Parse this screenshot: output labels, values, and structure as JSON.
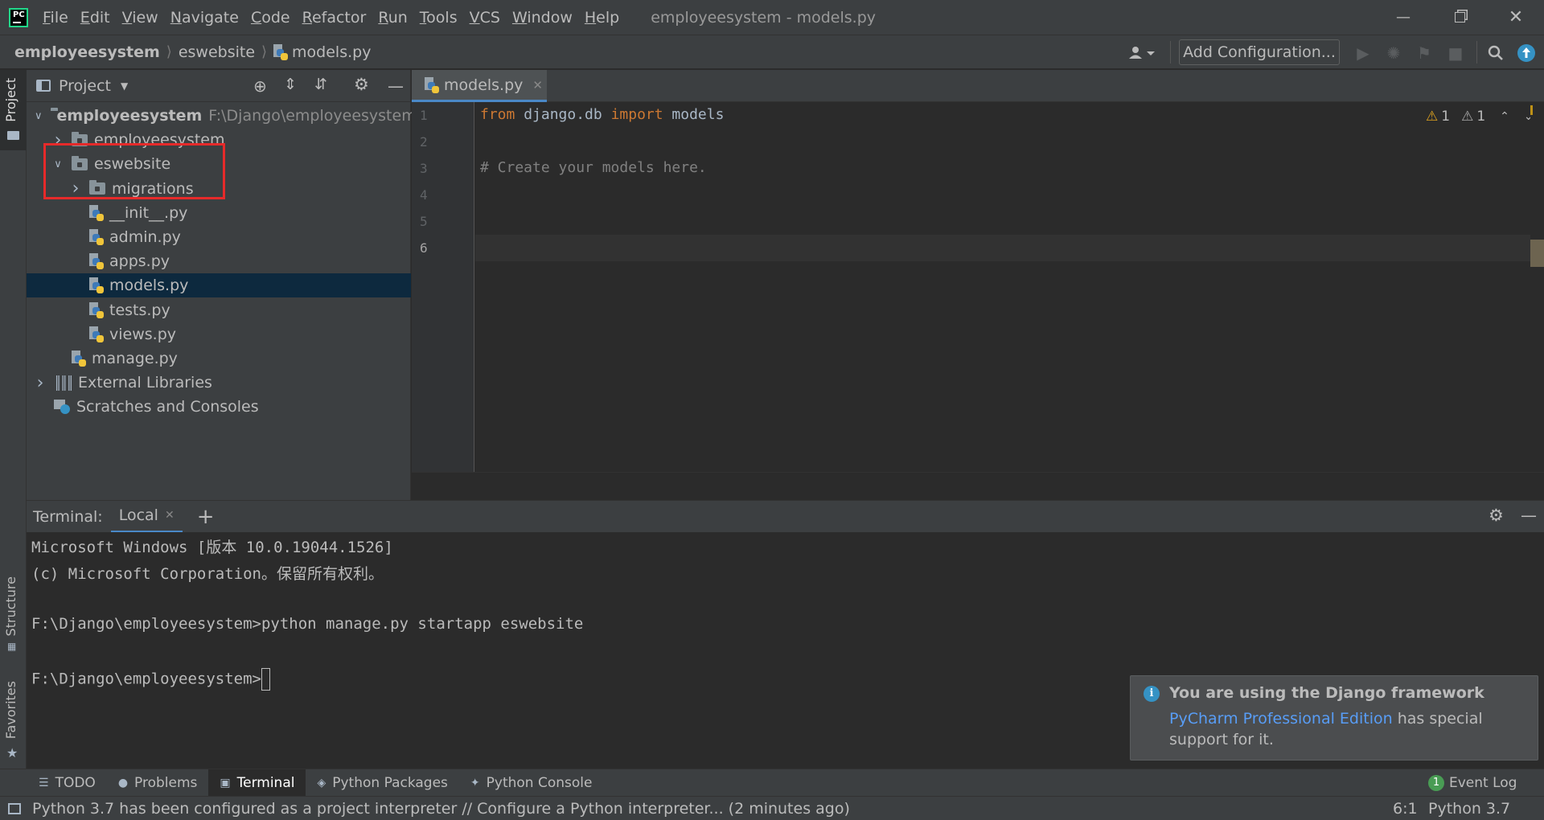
{
  "app": {
    "logo_text": "PC",
    "window_title": "employeesystem - models.py"
  },
  "menu": [
    "File",
    "Edit",
    "View",
    "Navigate",
    "Code",
    "Refactor",
    "Run",
    "Tools",
    "VCS",
    "Window",
    "Help"
  ],
  "menu_mnemonics": [
    "F",
    "E",
    "V",
    "N",
    "C",
    "R",
    "R",
    "T",
    "V",
    "W",
    "H"
  ],
  "breadcrumb": [
    "employeesystem",
    "eswebsite",
    "models.py"
  ],
  "toolbar": {
    "add_configuration": "Add Configuration..."
  },
  "left_strip": {
    "project": "Project",
    "structure": "Structure",
    "favorites": "Favorites"
  },
  "project_panel": {
    "title": "Project",
    "tree": [
      {
        "label": "employeesystem",
        "hint": "F:\\Django\\employeesystem",
        "type": "root-folder",
        "depth": 0,
        "expanded": true
      },
      {
        "label": "employeesystem",
        "type": "module-folder",
        "depth": 1,
        "expanded": false
      },
      {
        "label": "eswebsite",
        "type": "module-folder",
        "depth": 1,
        "expanded": true
      },
      {
        "label": "migrations",
        "type": "module-folder",
        "depth": 2,
        "expanded": false
      },
      {
        "label": "__init__.py",
        "type": "py",
        "depth": 2
      },
      {
        "label": "admin.py",
        "type": "py",
        "depth": 2
      },
      {
        "label": "apps.py",
        "type": "py",
        "depth": 2
      },
      {
        "label": "models.py",
        "type": "py",
        "depth": 2,
        "selected": true
      },
      {
        "label": "tests.py",
        "type": "py",
        "depth": 2
      },
      {
        "label": "views.py",
        "type": "py",
        "depth": 2
      },
      {
        "label": "manage.py",
        "type": "py",
        "depth": 1
      },
      {
        "label": "External Libraries",
        "type": "libs",
        "depth": 0,
        "expanded": false
      },
      {
        "label": "Scratches and Consoles",
        "type": "scratches",
        "depth": 0
      }
    ]
  },
  "editor": {
    "tab": "models.py",
    "warnings": [
      "1",
      "1"
    ],
    "line_numbers": [
      "1",
      "2",
      "3",
      "4",
      "5",
      "6"
    ],
    "lines": [
      [
        {
          "t": "from ",
          "c": "kw"
        },
        {
          "t": "django.db ",
          "c": "id"
        },
        {
          "t": "import ",
          "c": "kw"
        },
        {
          "t": "models",
          "c": "id"
        }
      ],
      [],
      [
        {
          "t": "# Create your models here.",
          "c": "cm"
        }
      ],
      [],
      [],
      []
    ],
    "current_line": "6"
  },
  "terminal": {
    "label": "Terminal:",
    "tab": "Local",
    "lines": [
      "Microsoft Windows [版本 10.0.19044.1526]",
      "(c) Microsoft Corporation。保留所有权利。",
      "",
      "F:\\Django\\employeesystem>python manage.py startapp eswebsite",
      "",
      "F:\\Django\\employeesystem>"
    ]
  },
  "notification": {
    "title": "You are using the Django framework",
    "link": "PyCharm Professional Edition",
    "text1": " has special",
    "text2": "support for it."
  },
  "tool_windows": [
    {
      "label": "TODO",
      "icon": "list-icon"
    },
    {
      "label": "Problems",
      "icon": "info-circle-icon"
    },
    {
      "label": "Terminal",
      "icon": "terminal-icon",
      "active": true
    },
    {
      "label": "Python Packages",
      "icon": "layers-icon"
    },
    {
      "label": "Python Console",
      "icon": "python-icon"
    }
  ],
  "event_log": {
    "label": "Event Log",
    "count": "1"
  },
  "status": {
    "message": "Python 3.7 has been configured as a project interpreter // Configure a Python interpreter... (2 minutes ago)",
    "position": "6:1",
    "interpreter": "Python 3.7"
  },
  "colors": {
    "keyword": "#cc7832",
    "identifier": "#a9b7c6",
    "comment": "#808080",
    "link": "#589df6",
    "accent": "#4a88c7",
    "highlight_box": "#e62a2a"
  }
}
